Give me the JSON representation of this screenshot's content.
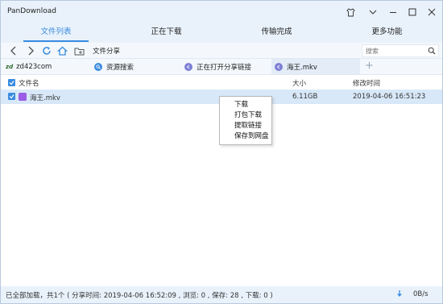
{
  "app": {
    "title": "PanDownload"
  },
  "tabs": [
    {
      "label": "文件列表",
      "active": true
    },
    {
      "label": "正在下载",
      "active": false
    },
    {
      "label": "传输完成",
      "active": false
    },
    {
      "label": "更多功能",
      "active": false
    }
  ],
  "toolbar": {
    "path": "文件分享",
    "search_placeholder": "搜索"
  },
  "sites": [
    {
      "label": "zd423com",
      "icon": "zd-logo-icon"
    },
    {
      "label": "资源搜索",
      "icon": "search-circle-icon"
    },
    {
      "label": "正在打开分享链接",
      "icon": "share-icon"
    },
    {
      "label": "海王.mkv",
      "icon": "share-icon",
      "selected": true
    }
  ],
  "list": {
    "columns": {
      "name": "文件名",
      "size": "大小",
      "modified": "修改时间"
    },
    "rows": [
      {
        "name": "海王.mkv",
        "size": "6.11GB",
        "modified": "2019-04-06 16:51:23",
        "checked": true
      }
    ]
  },
  "context_menu": {
    "items": [
      "下载",
      "打包下载",
      "提取链接",
      "保存到网盘"
    ]
  },
  "status": {
    "text": "已全部加载，共1个 ( 分享时间: 2019-04-06 16:52:09 , 浏览: 0 , 保存: 28 , 下载: 0 )",
    "speed": "0B/s"
  },
  "colors": {
    "accent": "#3a8be0",
    "titlebar": "#e9f2fb",
    "selected_row": "#d8e8f8",
    "file_icon": "#9b5de5"
  }
}
